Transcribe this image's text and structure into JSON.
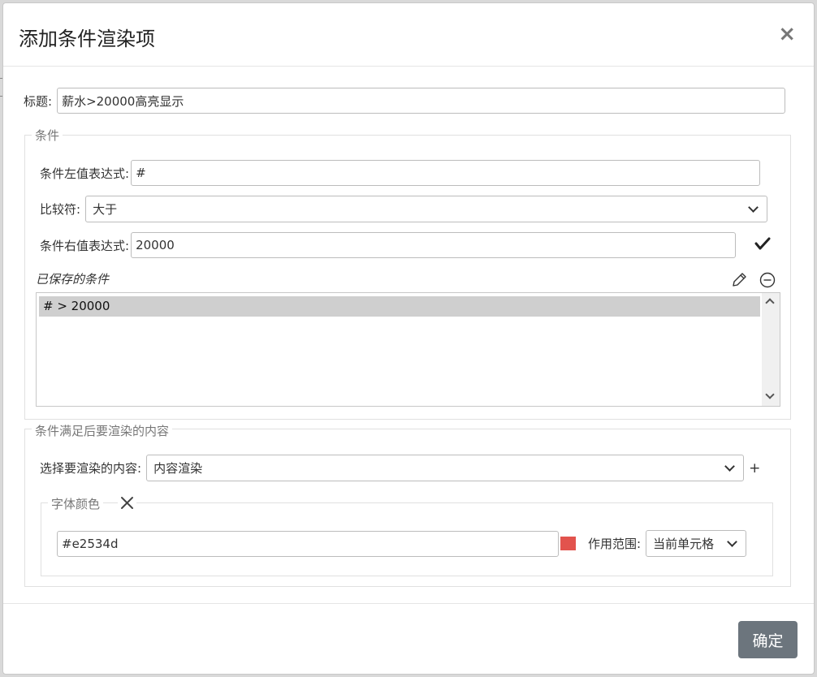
{
  "dialog": {
    "title": "添加条件渲染项",
    "close_symbol": "×"
  },
  "title_field": {
    "label": "标题:",
    "value": "薪水>20000高亮显示"
  },
  "condition_section": {
    "legend": "条件",
    "left_expr_label": "条件左值表达式:",
    "left_expr_value": "#",
    "comparator_label": "比较符:",
    "comparator_value": "大于",
    "right_expr_label": "条件右值表达式:",
    "right_expr_value": "20000",
    "saved_label": "已保存的条件",
    "saved_items": [
      "# > 20000"
    ]
  },
  "render_section": {
    "legend": "条件满足后要渲染的内容",
    "select_label": "选择要渲染的内容:",
    "select_value": "内容渲染",
    "add_symbol": "+",
    "font_color": {
      "legend": "字体颜色",
      "value": "#e2534d",
      "swatch_color": "#e2534d",
      "scope_label": "作用范围:",
      "scope_value": "当前单元格"
    }
  },
  "footer": {
    "confirm_label": "确定"
  },
  "icons": {
    "close": "close-icon",
    "confirm_check": "checkmark-icon",
    "edit": "pencil-icon",
    "remove": "minus-circle-icon",
    "remove_font_color": "x-icon",
    "dropdown": "chevron-down-icon"
  }
}
